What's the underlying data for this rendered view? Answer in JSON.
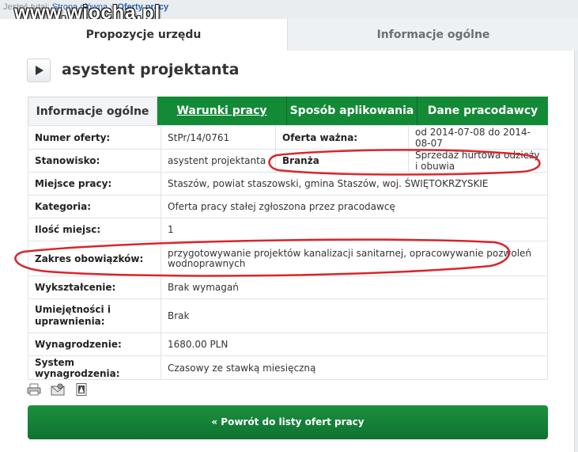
{
  "breadcrumb": {
    "prefix": "Jesteś tutaj:",
    "home": "Strona główna",
    "separator": "»",
    "current": "Oferty pracy"
  },
  "watermark": "www.wiocha.pl",
  "tabs": [
    {
      "label": "Propozycje urzędu",
      "active": true
    },
    {
      "label": "Informacje ogólne",
      "active": false
    }
  ],
  "job": {
    "title": "asystent projektanta"
  },
  "subtabs": [
    {
      "label": "Informacje ogólne"
    },
    {
      "label": "Warunki pracy"
    },
    {
      "label": "Sposób aplikowania"
    },
    {
      "label": "Dane pracodawcy"
    }
  ],
  "details": {
    "numer_label": "Numer oferty:",
    "numer_value": "StPr/14/0761",
    "wazna_label": "Oferta ważna:",
    "wazna_value": "od 2014-07-08 do 2014-08-07",
    "stanowisko_label": "Stanowisko:",
    "stanowisko_value": "asystent projektanta",
    "branza_label": "Branża",
    "branza_value": "Sprzedaż hurtowa odzieży i obuwia",
    "miejsce_label": "Miejsce pracy:",
    "miejsce_value": "Staszów, powiat staszowski, gmina Staszów, woj. ŚWIĘTOKRZYSKIE",
    "kategoria_label": "Kategoria:",
    "kategoria_value": "Oferta pracy stałej zgłoszona przez pracodawcę",
    "ilosc_label": "Ilość miejsc:",
    "ilosc_value": "1",
    "zakres_label": "Zakres obowiązków:",
    "zakres_value": "przygotowywanie projektów kanalizacji sanitarnej, opracowywanie pozwoleń wodnoprawnych",
    "wyksztalcenie_label": "Wykształcenie:",
    "wyksztalcenie_value": "Brak wymagań",
    "umiejetnosci_label": "Umiejętności i uprawnienia:",
    "umiejetnosci_value": "Brak",
    "wynagrodzenie_label": "Wynagrodzenie:",
    "wynagrodzenie_value": "1680.00 PLN",
    "system_label": "System wynagrodzenia:",
    "system_value": "Czasowy ze stawką miesięczną"
  },
  "actions": {
    "icons": [
      "print-icon",
      "email-icon",
      "pdf-icon"
    ],
    "back_label": "« Powrót do listy ofert pracy"
  },
  "colors": {
    "accent_green": "#138a36",
    "annotation_red": "#d8262b",
    "link_blue": "#2a5fa8"
  }
}
